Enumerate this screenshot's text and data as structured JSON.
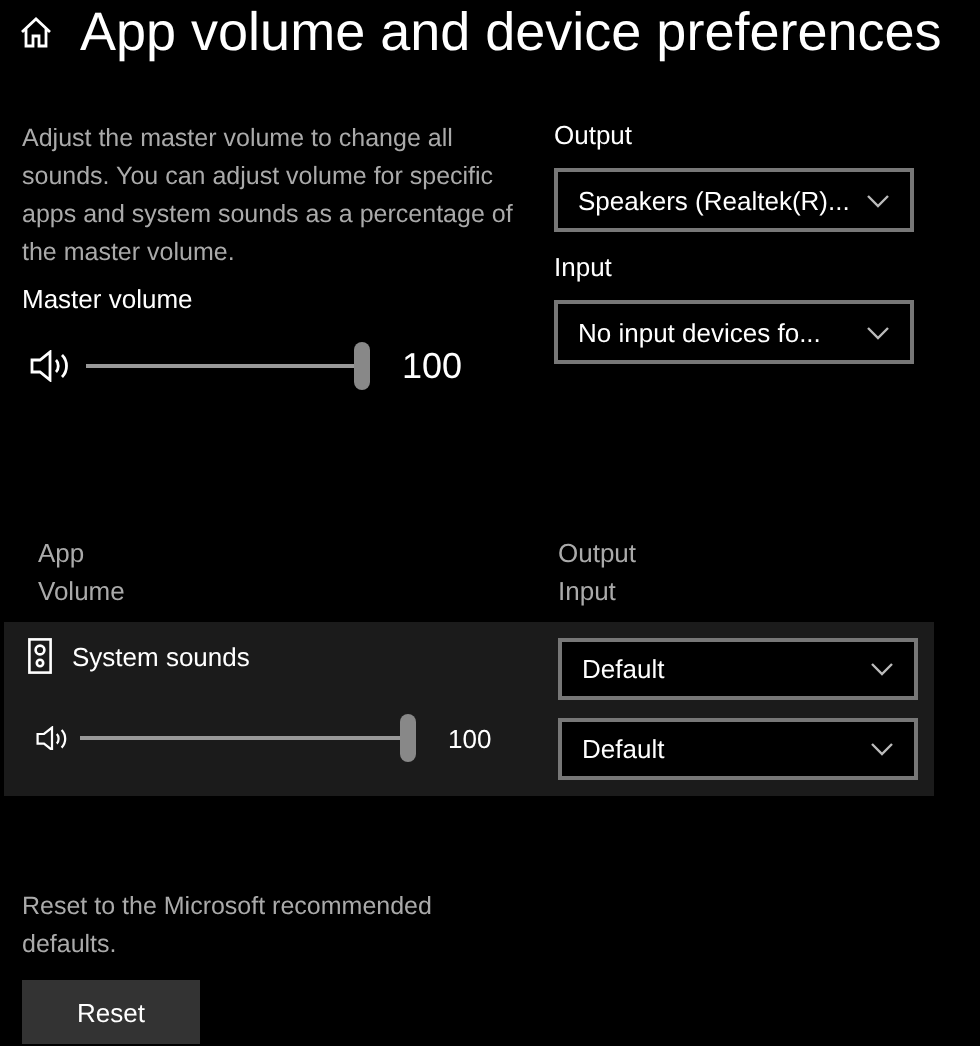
{
  "header": {
    "title": "App volume and device preferences"
  },
  "master": {
    "description": "Adjust the master volume to change all sounds. You can adjust volume for specific apps and system sounds as a percentage of the master volume.",
    "label": "Master volume",
    "level": 1,
    "reading": "100"
  },
  "devices": [
    {
      "label": "Output",
      "value": "Speakers (Realtek(R)..."
    },
    {
      "label": "Input",
      "value": "No input devices fo..."
    }
  ],
  "columns": {
    "left": [
      "App",
      "Volume"
    ],
    "right": [
      "Output",
      "Input"
    ]
  },
  "apps": [
    {
      "name": "System sounds",
      "level": 1,
      "reading": "100",
      "output": "Default",
      "input": "Default"
    }
  ],
  "reset": {
    "text": "Reset to the Microsoft recommended defaults.",
    "button": "Reset"
  }
}
